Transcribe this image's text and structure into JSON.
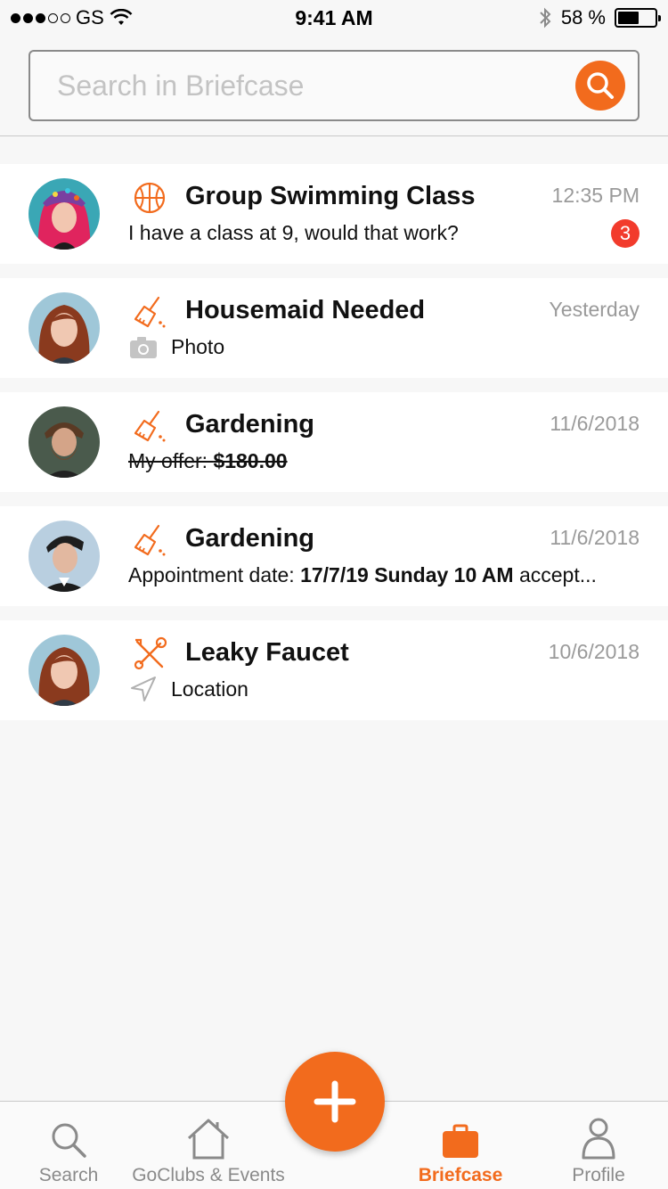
{
  "status_bar": {
    "carrier": "GS",
    "signal_filled": 3,
    "signal_total": 5,
    "time": "9:41 AM",
    "battery_percent": "58 %",
    "battery_level": 0.58
  },
  "search": {
    "placeholder": "Search in Briefcase",
    "value": ""
  },
  "conversations": [
    {
      "title": "Group Swimming Class",
      "time": "12:35 PM",
      "category_icon": "basketball-icon",
      "message": "I have a class at 9, would that work?",
      "unread": "3"
    },
    {
      "title": "Housemaid Needed",
      "time": "Yesterday",
      "category_icon": "broom-icon",
      "attachment_icon": "camera-icon",
      "message": "Photo"
    },
    {
      "title": "Gardening",
      "time": "11/6/2018",
      "category_icon": "broom-icon",
      "offer_label": "My offer: ",
      "offer_amount": "$180.00"
    },
    {
      "title": "Gardening",
      "time": "11/6/2018",
      "category_icon": "broom-icon",
      "appt_prefix": "Appointment date: ",
      "appt_date": "17/7/19 Sunday 10 AM",
      "appt_suffix": " accept..."
    },
    {
      "title": "Leaky Faucet",
      "time": "10/6/2018",
      "category_icon": "tools-icon",
      "attachment_icon": "location-arrow-icon",
      "message": "Location"
    }
  ],
  "tabs": [
    {
      "label": "Search",
      "icon": "search-icon"
    },
    {
      "label": "GoClubs & Events",
      "icon": "house-icon"
    },
    {
      "label": "Briefcase",
      "icon": "briefcase-icon",
      "active": true
    },
    {
      "label": "Profile",
      "icon": "person-icon"
    }
  ],
  "fab": {
    "icon": "plus-icon"
  },
  "colors": {
    "accent": "#f26b1d",
    "badge": "#f23b2c",
    "muted": "#9a9a9a"
  }
}
